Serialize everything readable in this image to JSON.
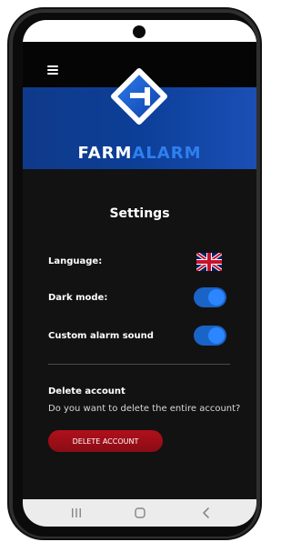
{
  "topbar": {
    "menu_icon": "hamburger-icon"
  },
  "hero": {
    "brand_part1": "FARM",
    "brand_part2": "ALARM",
    "brand_color_1": "#ffffff",
    "brand_color_2": "#2f7ff0",
    "logo_icon": "farmalarm-logo-icon"
  },
  "settings": {
    "title": "Settings",
    "language_label": "Language:",
    "language_icon": "uk-flag-icon",
    "dark_mode_label": "Dark mode:",
    "dark_mode_on": true,
    "custom_alarm_label": "Custom alarm sound",
    "custom_alarm_on": true,
    "delete_title": "Delete account",
    "delete_desc": "Do you want to delete the entire account?",
    "delete_button": "DELETE ACCOUNT"
  },
  "navbar": {
    "recent_icon": "recent-apps-icon",
    "home_icon": "home-icon",
    "back_icon": "back-icon"
  }
}
